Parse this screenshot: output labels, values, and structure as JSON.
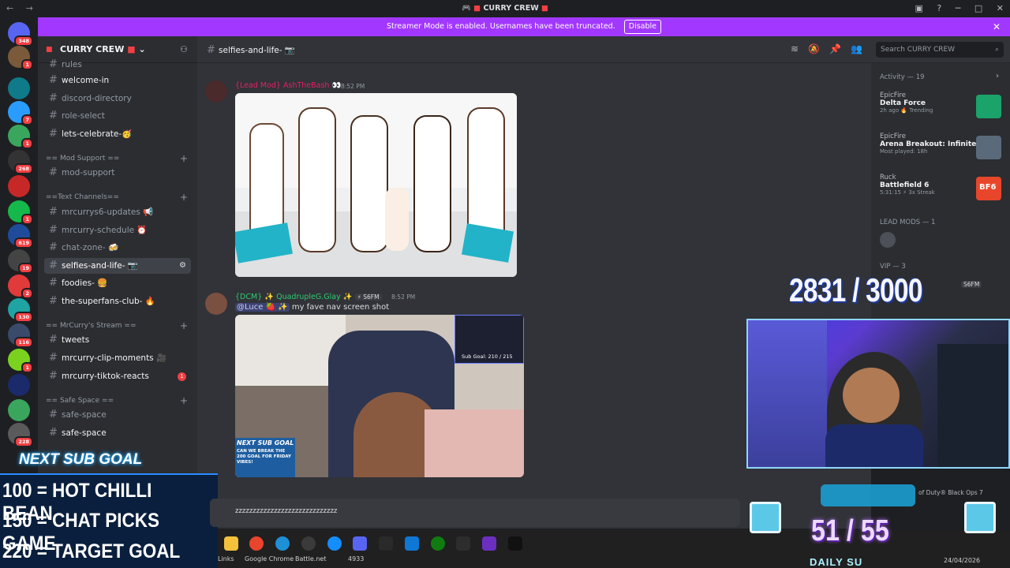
{
  "window": {
    "title": "CURRY CREW"
  },
  "banner": {
    "text": "Streamer Mode is enabled. Usernames have been truncated.",
    "button": "Disable"
  },
  "rail": {
    "servers": [
      {
        "count": "348",
        "color": "#5865f2"
      },
      {
        "count": "1",
        "color": "#7a5a3a"
      },
      {
        "count": "",
        "color": "#0e7a8a"
      },
      {
        "count": "7",
        "color": "#2b9cff"
      },
      {
        "count": "1",
        "color": "#3aa55d"
      },
      {
        "count": "268",
        "color": "#333"
      },
      {
        "count": "",
        "color": "#c62828"
      },
      {
        "count": "1",
        "color": "#15b84a"
      },
      {
        "count": "619",
        "color": "#1e4c9a"
      },
      {
        "count": "19",
        "color": "#444"
      },
      {
        "count": "2",
        "color": "#e03a3a"
      },
      {
        "count": "130",
        "color": "#1fa3a3"
      },
      {
        "count": "116",
        "color": "#3a4a6a"
      },
      {
        "count": "1",
        "color": "#7ad21e"
      },
      {
        "count": "",
        "color": "#1b2a6a"
      },
      {
        "count": "",
        "color": "#3aa55d"
      },
      {
        "count": "228",
        "color": "#5a5a5a"
      }
    ]
  },
  "sidebar": {
    "guild": "CURRY CREW",
    "channels_top": [
      "rules",
      "welcome-in",
      "discord-directory",
      "role-select",
      "lets-celebrate-🥳"
    ],
    "cat_mod": "== Mod Support ==",
    "mod_support": "mod-support",
    "cat_text": "==Text Channels==",
    "text_channels": [
      "mrcurrys6-updates 📢",
      "mrcurry-schedule ⏰",
      "chat-zone- 🍻",
      "selfies-and-life- 📷",
      "foodies- 🍔",
      "the-superfans-club- 🔥"
    ],
    "cat_stream": "== MrCurry's Stream ==",
    "stream_channels": [
      "tweets",
      "mrcurry-clip-moments 🎥",
      "mrcurry-tiktok-reacts"
    ],
    "tiktok_badge": "1",
    "cat_safe": "== Safe Space ==",
    "safe_channels": [
      "safe-space",
      "safe-space"
    ]
  },
  "header": {
    "channel": "selfies-and-life- 📷",
    "search_placeholder": "Search  CURRY CREW"
  },
  "messages": [
    {
      "author": "{Lead Mod} AshTheBash 👀",
      "time": "8:52 PM",
      "author_color": "#e91e63"
    },
    {
      "author": "{DCM} ✨ QuadrupleG.Glay ✨",
      "tag": "⚡ S6FM",
      "time": "8:52 PM",
      "author_color": "#2ecc71",
      "text_prefix": "@Luce 🍓 ✨",
      "text": "my fave nav screen shot"
    }
  ],
  "embed2": {
    "goal_text": "Sub Goal: 210 / 215",
    "next_sub": "NEXT SUB GOAL",
    "next_sub_body": "CAN WE BREAK THE 200 GOAL FOR FRIDAY VIBES!"
  },
  "input": {
    "text": "zzzzzzzzzzzzzzzzzzzzzzzzzzzzz"
  },
  "right_panel": {
    "activity_title": "Activity — 19",
    "activities": [
      {
        "user": "EpicFire",
        "game": "Delta Force",
        "status": "2h ago  🔥 Trending",
        "thumb_color": "#1aa36a"
      },
      {
        "user": "EpicFire",
        "game": "Arena Breakout: Infinite",
        "status": "Most played: 18h",
        "thumb_color": "#5a6a7a"
      },
      {
        "user": "Ruck",
        "game": "Battlefield 6",
        "status": "5:31:15  ⚡ 3x Streak",
        "thumb_color": "#e8462a",
        "thumb_text": "BF6"
      }
    ],
    "lead_mods": "LEAD MODS — 1",
    "vip": "VIP — 3",
    "vip_tag": "S6FM"
  },
  "overlay": {
    "sub_count": "2831 / 3000",
    "next_sub_goal": "NEXT SUB GOAL",
    "goals": [
      "100 = HOT CHILLI BEAN",
      "150 = CHAT PICKS GAME",
      "220 = TARGET GOAL"
    ],
    "daily_count": "51 / 55",
    "daily_label": "DAILY SU",
    "cod_text": "of Duty® Black Ops 7",
    "date": "24/04/2026"
  },
  "taskbar": {
    "links": [
      "Links",
      "Google Chrome",
      "Battle.net",
      "4933"
    ]
  }
}
